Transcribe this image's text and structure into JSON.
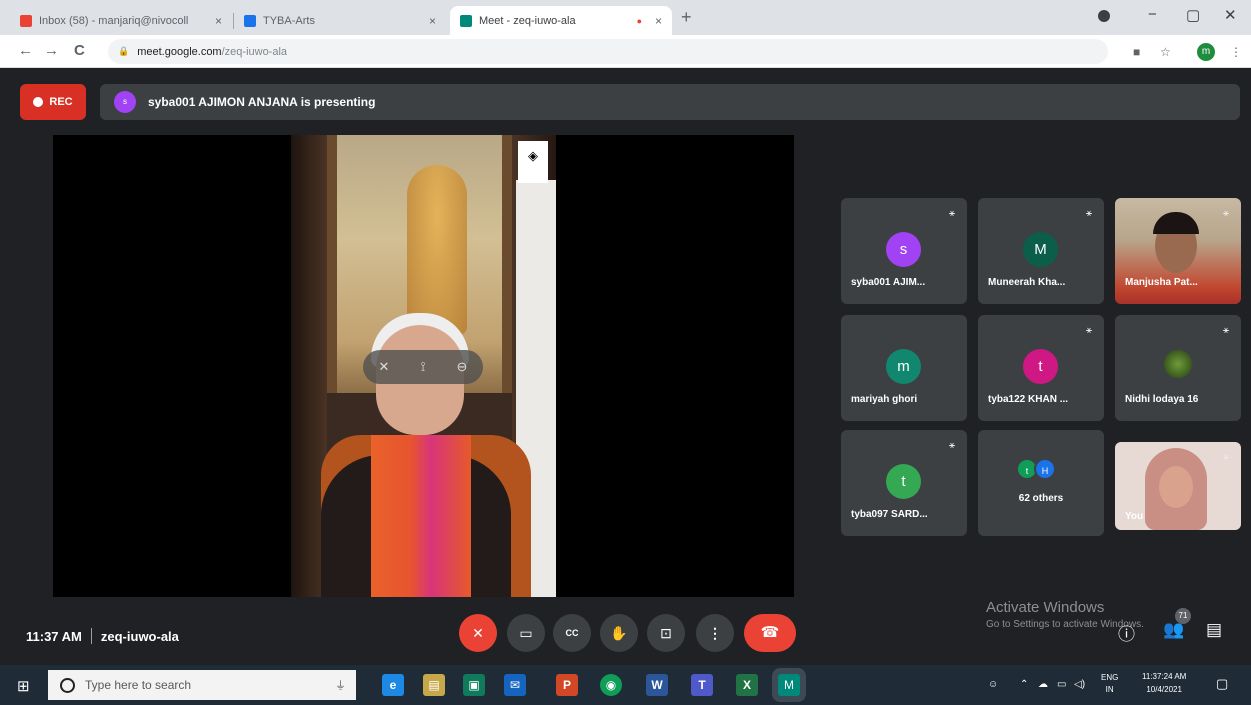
{
  "browser": {
    "tabs": [
      {
        "label": "Inbox (58) - manjariq@nivocoll ",
        "close": "×",
        "favicon_color": "#ea4335"
      },
      {
        "label": "TYBA-Arts",
        "close": "×",
        "favicon_color": "#1a73e8"
      },
      {
        "label": "Meet - zeq-iuwo-ala",
        "close": "×",
        "favicon_color": "#00897b",
        "active": true,
        "recording_dot": "●"
      }
    ],
    "new_tab": "+",
    "window_controls": {
      "minimize": "−",
      "maximize": "▢",
      "close": "✕"
    },
    "nav": {
      "back": "←",
      "forward": "→",
      "reload": "C"
    },
    "lock": "🔒",
    "url_host": "meet.google.com",
    "url_path": "/zeq-iuwo-ala",
    "profile_letter": "m"
  },
  "meet": {
    "rec_label": "REC",
    "presenter": {
      "avatar_letter": "s",
      "text": "syba001 AJIMON ANJANA is presenting"
    },
    "pin_icon": "◈",
    "tiles": [
      {
        "name": "syba001 AJIM...",
        "letter": "s",
        "color": "#a142f4",
        "mic": "✎̸"
      },
      {
        "name": "Muneerah Kha...",
        "letter": "M",
        "color": "#0b5e4a",
        "mic": "✎̸"
      },
      {
        "name": "Manjusha Pat...",
        "letter": "",
        "color": "",
        "mic": "✎̸",
        "photo": true
      },
      {
        "name": "mariyah ghori",
        "letter": "m",
        "color": "#12876f",
        "mic": ""
      },
      {
        "name": "tyba122 KHAN ...",
        "letter": "t",
        "color": "#d01884",
        "mic": "✎̸"
      },
      {
        "name": "Nidhi lodaya 16",
        "letter": "",
        "color": "",
        "mic": "✎̸",
        "photo": true
      },
      {
        "name": "tyba097 SARD...",
        "letter": "t",
        "color": "#34a853",
        "mic": "✎̸"
      },
      {
        "name": "You",
        "letter": "",
        "color": "",
        "mic": "✎̸",
        "photo": true
      }
    ],
    "others": {
      "label": "62 others",
      "avatars": [
        {
          "letter": "t",
          "color": "#0f9d58"
        },
        {
          "letter": "H",
          "color": "#1a73e8"
        }
      ]
    },
    "time": "11:37 AM",
    "meeting_code": "zeq-iuwo-ala",
    "controls": {
      "mic": "✎̸",
      "camera": "▭",
      "captions": "CC",
      "hand": "✋",
      "present": "⊡",
      "more": "⋮",
      "end": "☎"
    },
    "activate": {
      "title": "Activate Windows",
      "subtitle": "Go to Settings to activate Windows."
    },
    "participant_count": "71"
  },
  "taskbar": {
    "search_placeholder": "Type here to search",
    "mic": "🎙",
    "apps": [
      {
        "glyph": "e",
        "color": "#1e88e5"
      },
      {
        "glyph": "▤",
        "color": "#c6a84b"
      },
      {
        "glyph": "▣",
        "color": "#0f7b5a"
      },
      {
        "glyph": "✉",
        "color": "#1565c0"
      },
      {
        "glyph": "P",
        "color": "#d24726"
      },
      {
        "glyph": "◉",
        "color": "#0f9d58"
      },
      {
        "glyph": "W",
        "color": "#2b579a"
      },
      {
        "glyph": "T",
        "color": "#5059c9"
      },
      {
        "glyph": "X",
        "color": "#217346"
      },
      {
        "glyph": "M",
        "color": "#00897b"
      }
    ],
    "lang_top": "ENG",
    "lang_bottom": "IN",
    "clock_time": "11:37:24 AM",
    "clock_date": "10/4/2021"
  }
}
